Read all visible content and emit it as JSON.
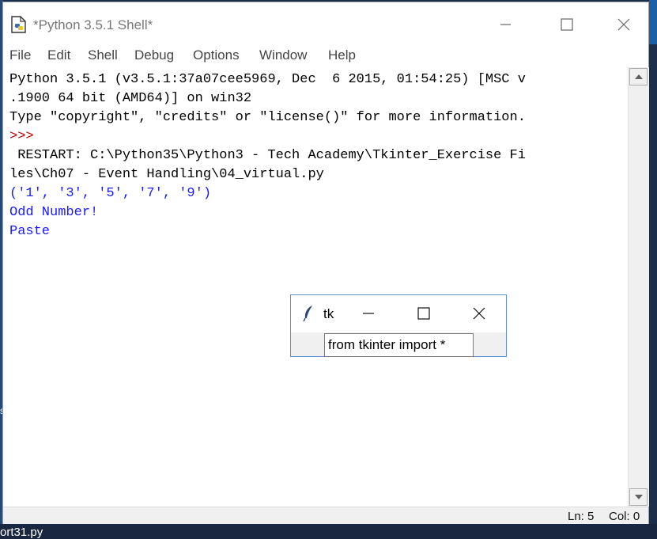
{
  "window": {
    "title": "*Python 3.5.1 Shell*"
  },
  "menu": [
    "File",
    "Edit",
    "Shell",
    "Debug",
    "Options",
    "Window",
    "Help"
  ],
  "shell_lines": [
    {
      "text": "Python 3.5.1 (v3.5.1:37a07cee5969, Dec  6 2015, 01:54:25) [MSC v",
      "color": "black"
    },
    {
      "text": ".1900 64 bit (AMD64)] on win32",
      "color": "black"
    },
    {
      "text": "Type \"copyright\", \"credits\" or \"license()\" for more information.",
      "color": "black"
    },
    {
      "text": ">>> ",
      "color": "red"
    },
    {
      "text": " RESTART: C:\\Python35\\Python3 - Tech Academy\\Tkinter_Exercise Fi",
      "color": "black"
    },
    {
      "text": "les\\Ch07 - Event Handling\\04_virtual.py ",
      "color": "black"
    },
    {
      "text": "('1', '3', '5', '7', '9')",
      "color": "blue"
    },
    {
      "text": "Odd Number!",
      "color": "blue"
    },
    {
      "text": "Paste",
      "color": "blue"
    }
  ],
  "status": {
    "line": "Ln: 5",
    "col": "Col: 0"
  },
  "tk_window": {
    "title": "tk",
    "entry_value": "from tkinter import *"
  },
  "desktop": {
    "file_fragment": "ort31.py",
    "side_fragment": "s"
  },
  "colors": {
    "output_blue": "#1a1aff",
    "prompt_red": "#c00000",
    "text_black": "#000000"
  },
  "icons": {
    "app": "python-idle-icon",
    "tk": "tk-feather-icon"
  }
}
